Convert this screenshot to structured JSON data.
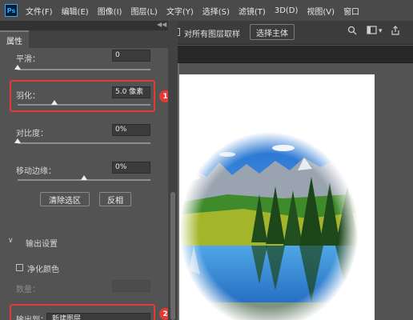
{
  "menubar": {
    "logo": "Ps",
    "items": [
      "文件(F)",
      "编辑(E)",
      "图像(I)",
      "图层(L)",
      "文字(Y)",
      "选择(S)",
      "滤镜(T)",
      "3D(D)",
      "视图(V)",
      "窗口"
    ]
  },
  "options": {
    "align_layers_label": "对所有图层取样",
    "select_subject_label": "选择主体"
  },
  "panel": {
    "tab_label": "属性",
    "smooth": {
      "label": "平滑：",
      "value": "0",
      "slider": 0
    },
    "feather": {
      "label": "羽化：",
      "value": "5.0 像素",
      "slider": 0.28
    },
    "contrast": {
      "label": "对比度：",
      "value": "0%",
      "slider": 0
    },
    "shift_edge": {
      "label": "移动边缘：",
      "value": "0%",
      "slider": 0.5
    },
    "clear_selection_label": "清除选区",
    "invert_label": "反相",
    "output_settings_label": "输出设置",
    "decontaminate_label": "净化颜色",
    "amount_label": "数量：",
    "output_to_label": "输出到：",
    "output_to_value": "新建图层"
  },
  "annotations": {
    "badge_1": "1",
    "badge_2": "2"
  },
  "colors": {
    "highlight": "#e53935",
    "menubar": "#4a4a4a",
    "panel": "#535353",
    "options_bar": "#3c3c3c"
  }
}
